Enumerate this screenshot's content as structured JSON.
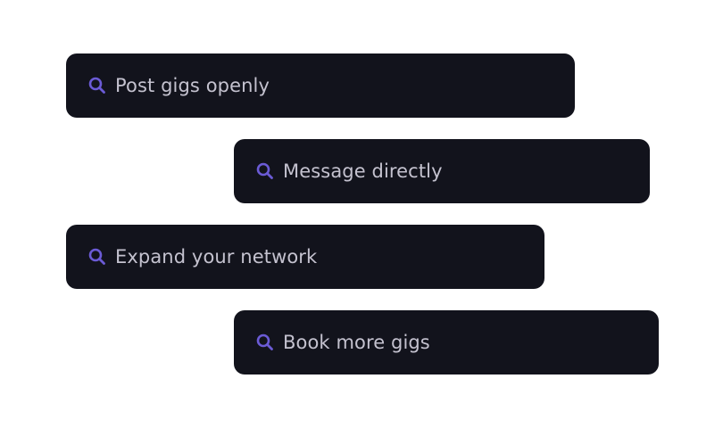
{
  "accent_color": "#6b5bd6",
  "pill_background": "#12131c",
  "text_color": "#c4c2cf",
  "items": [
    {
      "label": "Post gigs openly",
      "icon": "search-icon"
    },
    {
      "label": "Message directly",
      "icon": "search-icon"
    },
    {
      "label": "Expand your network",
      "icon": "search-icon"
    },
    {
      "label": "Book more gigs",
      "icon": "search-icon"
    }
  ]
}
